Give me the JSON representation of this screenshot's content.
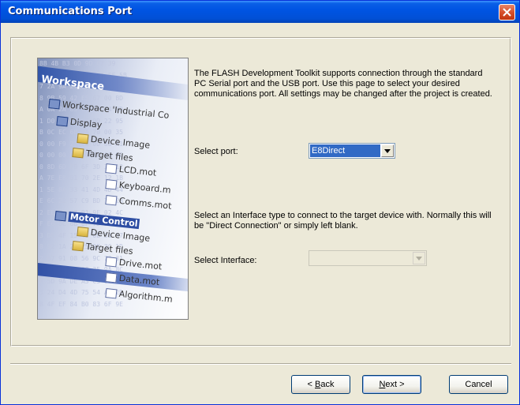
{
  "window": {
    "title": "Communications Port"
  },
  "illustration": {
    "banner": "Workspace",
    "hex_lines": [
      "8B 4B B3 0D 9D C7 39",
      "6E A3 46 9B 82 DA FF 5B",
      "7 2A 9A 21 9A 4D 5D 19",
      "8 9B 59 42 E5 67 00 BD",
      "A 0A 2A 85 F0 17 74 9D",
      "1 D0 C5 45 6E 9D 22 95",
      "B 0C EC 6B 4A 70 00 35",
      "0 00 F9 22 EE 0D 88 A1",
      "0 00 00 00 00 00 00 00",
      "0 8D 6D F9 6F 3D 3C 12",
      "A 7E E8 B1 70 2E 12 1B",
      "1 5E 8A 33 41 4D 4D 44",
      "E 6C 22 57 C9 BD 7E 28",
      "2 EE A0 B7 91 9E 02 4C",
      "F E6 8C 6B 8F 7D D4 BF",
      "3 DE 4F 15 43 0B 31 57",
      "8 92 1A 2C 25 9E 3C 1D",
      "2 67 91 08 56 9C 72 31",
      "6 F0 58 FD 38 35 9A 8C",
      "E 5D 9A DE A3 C5 64 85",
      "3 24 D4 4D 75 54 AD 2D",
      "8 4F EF 84 B0 83 6F 9E"
    ],
    "tree": {
      "workspace": "Workspace 'Industrial Co",
      "display": "Display",
      "device_image": "Device Image",
      "target_files": "Target files",
      "lcd": "LCD.mot",
      "keyboard": "Keyboard.m",
      "comms": "Comms.mot",
      "motor_control": "Motor Control",
      "device_image2": "Device Image",
      "target_files2": "Target files",
      "drive": "Drive.mot",
      "data": "Data.mot",
      "algorithm": "Algorithm.m"
    }
  },
  "description": "The FLASH Development Toolkit supports connection through the standard PC Serial port and the USB port. Use this page to select your desired communications port. All settings may be changed after the project is created.",
  "port": {
    "label": "Select port:",
    "value": "E8Direct"
  },
  "interface_desc": "Select an Interface type to connect to the target device with. Normally this will be \"Direct Connection\" or simply left blank.",
  "interface": {
    "label": "Select Interface:",
    "value": ""
  },
  "buttons": {
    "back_prefix": "< ",
    "back_key": "B",
    "back_rest": "ack",
    "next_key": "N",
    "next_rest": "ext >",
    "cancel": "Cancel"
  },
  "colors": {
    "titlebar": "#0054e3",
    "dialog_bg": "#ece9d8",
    "selection": "#316ac5"
  }
}
